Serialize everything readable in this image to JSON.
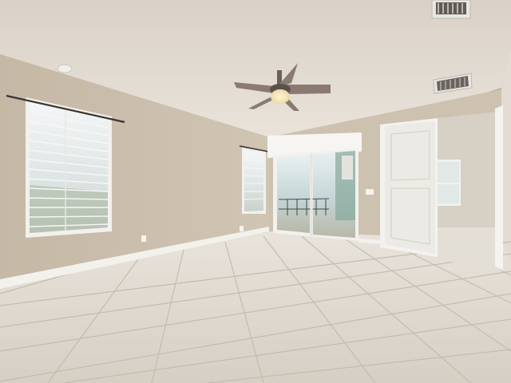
{
  "scene": {
    "subject": "empty-room-interior",
    "colors": {
      "ceiling": "#e4ddd4",
      "wall_left": "#c8bba9",
      "wall_back": "#cfc3b2",
      "wall_right": "#d8d1c7",
      "floor": "#ded8cf",
      "grout": "#c3bbaf",
      "baseboard": "#f3f1ec",
      "trim": "#f6f5f1",
      "glass": "#cfe0e6",
      "fan_blade": "#8a7a72",
      "fan_light": "#f3e4b5"
    }
  }
}
